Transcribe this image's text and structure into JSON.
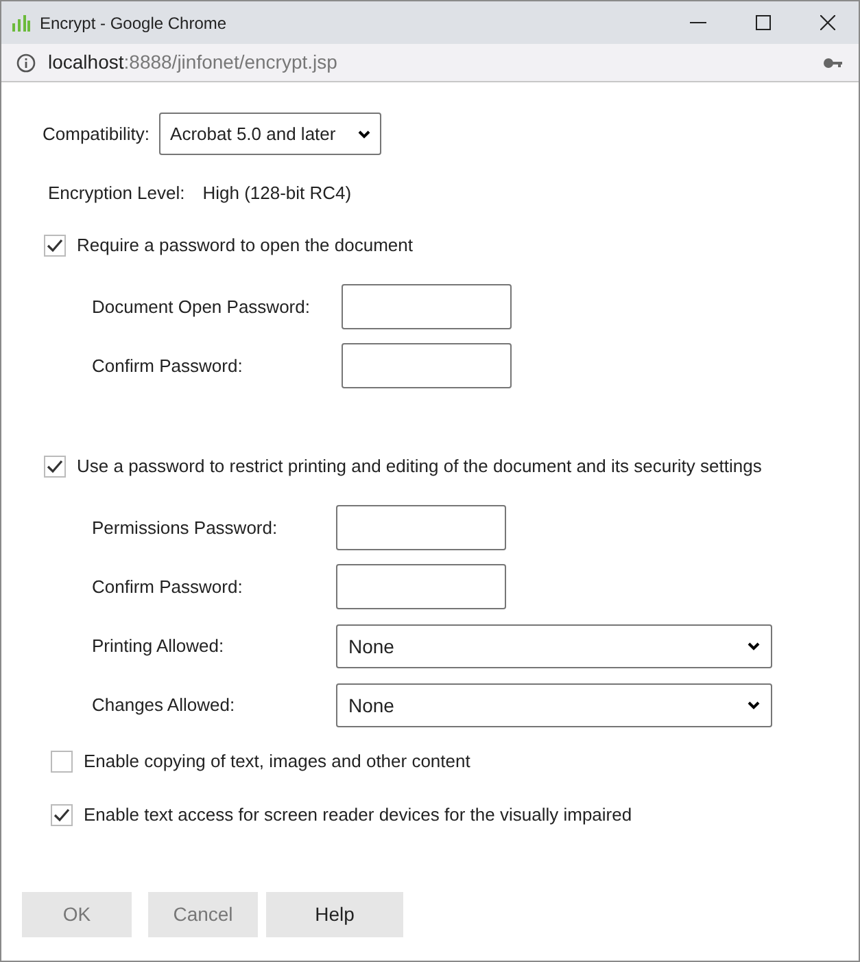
{
  "window": {
    "title": "Encrypt - Google Chrome"
  },
  "address_bar": {
    "host": "localhost",
    "path": ":8888/jinfonet/encrypt.jsp"
  },
  "compatibility": {
    "label": "Compatibility:",
    "value": "Acrobat 5.0 and later"
  },
  "encryption_level": {
    "label": "Encryption Level:",
    "value": "High (128-bit RC4)"
  },
  "open_password": {
    "label": "Require a password to open the document",
    "checked": true,
    "fields": [
      {
        "label": "Document Open Password:"
      },
      {
        "label": "Confirm Password:"
      }
    ]
  },
  "permissions": {
    "label": "Use a password to restrict printing and editing of the document and its security settings",
    "checked": true,
    "fields": [
      {
        "label": "Permissions Password:",
        "kind": "input"
      },
      {
        "label": "Confirm Password:",
        "kind": "input"
      },
      {
        "label": "Printing Allowed:",
        "kind": "select",
        "value": "None"
      },
      {
        "label": "Changes Allowed:",
        "kind": "select",
        "value": "None"
      }
    ]
  },
  "options": [
    {
      "label": "Enable copying of text, images and other content",
      "checked": false
    },
    {
      "label": "Enable text access for screen reader devices for the visually impaired",
      "checked": true
    }
  ],
  "buttons": [
    {
      "label": "OK",
      "disabled": true
    },
    {
      "label": "Cancel",
      "disabled": true
    },
    {
      "label": "Help",
      "disabled": false
    }
  ]
}
